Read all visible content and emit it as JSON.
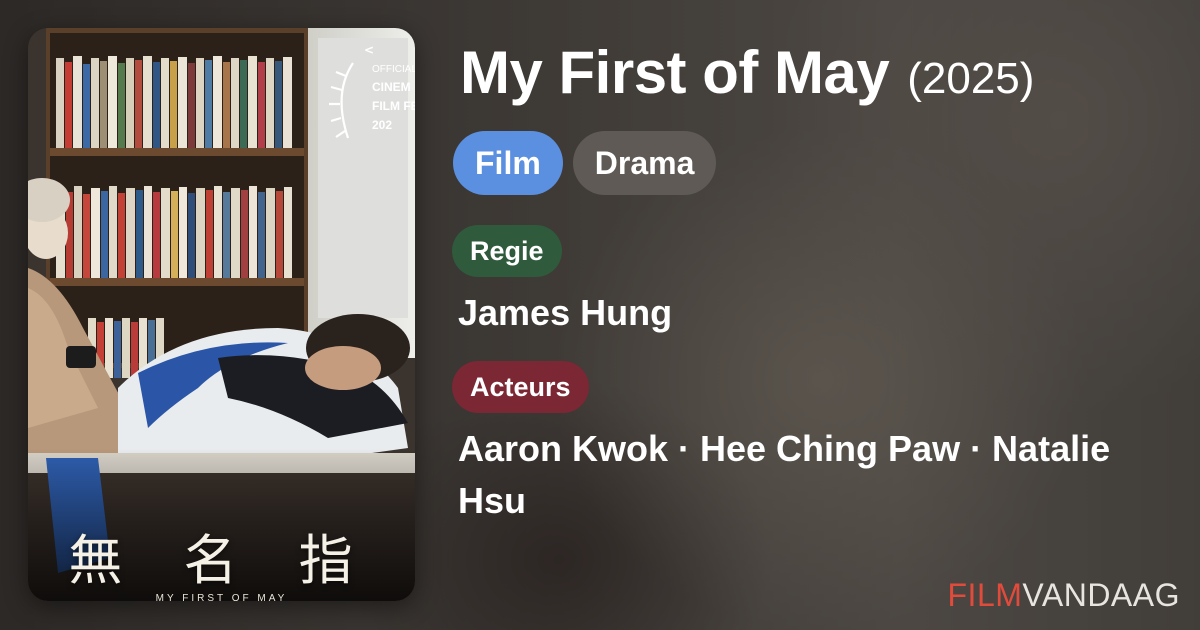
{
  "poster": {
    "cjk_title": "無 名 指",
    "english_title": "MY FIRST OF MAY",
    "festival_line1": "OFFICIAL S",
    "festival_line2": "CINEM",
    "festival_line3": "FILM FE",
    "festival_year": "202"
  },
  "movie": {
    "title": "My First of May",
    "year": "(2025)"
  },
  "genres": [
    "Film",
    "Drama"
  ],
  "colors": {
    "film_pill": "#5b8fe0",
    "drama_pill": "#5f5a55",
    "regie_tag": "#2f5a3c",
    "acteurs_tag": "#7b2734",
    "brand_red": "#e14b3c"
  },
  "credits": {
    "director_label": "Regie",
    "director": "James Hung",
    "cast_label": "Acteurs",
    "cast": "Aaron Kwok · Hee Ching Paw · Natalie Hsu"
  },
  "brand": {
    "part1": "FILM",
    "part2": "VANDAAG"
  }
}
